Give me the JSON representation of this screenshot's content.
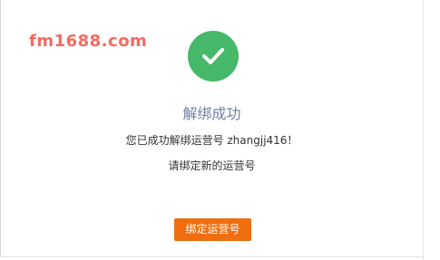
{
  "watermark": {
    "text": "fm1688.com"
  },
  "result": {
    "icon": "checkmark-icon",
    "title": "解绑成功",
    "message": "您已成功解绑运营号 zhangjj416！",
    "prompt": "请绑定新的运营号"
  },
  "actions": {
    "bind_label": "绑定运营号"
  },
  "colors": {
    "success": "#45b86a",
    "title": "#6e7fa3",
    "button": "#f06e0f",
    "watermark": "#f26b60"
  }
}
